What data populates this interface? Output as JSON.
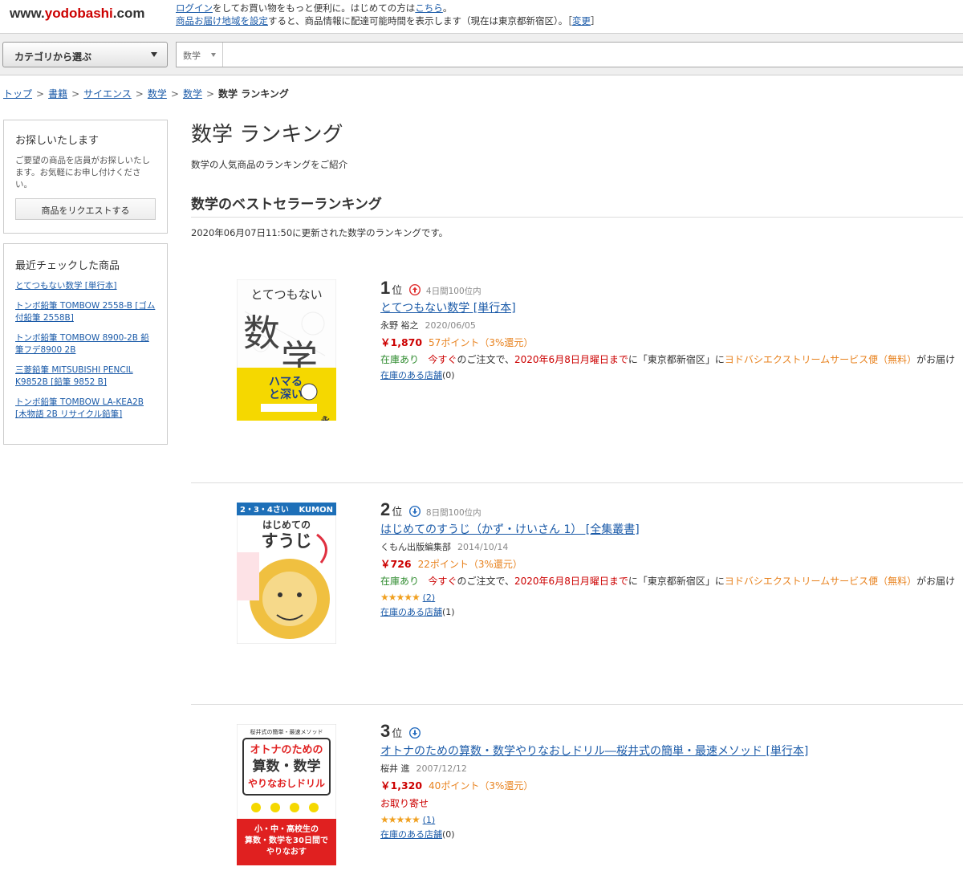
{
  "header": {
    "logo_part1": "www.",
    "logo_part2": "yodobashi",
    "logo_part3": ".com",
    "line1_link1": "ログイン",
    "line1_text1": "をしてお買い物をもっと便利に。はじめての方は",
    "line1_link2": "こちら",
    "line1_text2": "。",
    "line2_link1": "商品お届け地域を設定",
    "line2_text1": "すると、商品情報に配達可能時間を表示します（現在は東京都新宿区）。［",
    "line2_link2": "変更",
    "line2_text2": "］"
  },
  "search": {
    "category_label": "カテゴリから選ぶ",
    "scope_label": "数学",
    "input_value": ""
  },
  "breadcrumb": {
    "items": [
      "トップ",
      "書籍",
      "サイエンス",
      "数学",
      "数学"
    ],
    "separator": ">",
    "current": "数学 ランキング"
  },
  "sidebar": {
    "request": {
      "title": "お探しいたします",
      "text": "ご要望の商品を店員がお探しいたします。お気軽にお申し付けください。",
      "button": "商品をリクエストする"
    },
    "recent": {
      "title": "最近チェックした商品",
      "items": [
        "とてつもない数学 [単行本]",
        "トンボ鉛筆 TOMBOW 2558-B [ゴム付鉛筆 2558B]",
        "トンボ鉛筆 TOMBOW 8900-2B 鉛筆フデ8900 2B",
        "三菱鉛筆 MITSUBISHI PENCIL K9852B [鉛筆 9852 B]",
        "トンボ鉛筆 TOMBOW LA-KEA2B [木物語 2B リサイクル鉛筆]"
      ]
    }
  },
  "main": {
    "title": "数学 ランキング",
    "description": "数学の人気商品のランキングをご紹介",
    "section_title": "数学のベストセラーランキング",
    "updated": "2020年06月07日11:50に更新された数学のランキングです。"
  },
  "ranking": [
    {
      "rank": "1",
      "rank_suffix": "位",
      "trend": "up",
      "trend_icon": "arrow-up-icon",
      "trend_color": "#e03030",
      "note": "4日間100位内",
      "title": "とてつもない数学 [単行本]",
      "author": "永野 裕之",
      "date": "2020/06/05",
      "price": "￥1,870",
      "points": "57ポイント（3%還元）",
      "stock_status": "在庫あり",
      "delivery_a": "今すぐ",
      "delivery_b": "のご注文で、",
      "delivery_c": "2020年6月8日月曜日まで",
      "delivery_d": "に「東京都新宿区」に",
      "delivery_e": "ヨドバシエクストリームサービス便（無料）",
      "delivery_f": "がお届け",
      "store_link": "在庫のある店舗",
      "store_count": "(0)",
      "cover": {
        "bg": "#ffffff",
        "title": "とてつもない",
        "big": "数学",
        "band_color": "#f5d800",
        "author": "永野裕之"
      }
    },
    {
      "rank": "2",
      "rank_suffix": "位",
      "trend": "down",
      "trend_icon": "arrow-down-icon",
      "trend_color": "#2a6fc0",
      "note": "8日間100位内",
      "title": "はじめてのすうじ（かず・けいさん 1） [全集叢書]",
      "author": "くもん出版編集部",
      "date": "2014/10/14",
      "price": "￥726",
      "points": "22ポイント（3%還元）",
      "stock_status": "在庫あり",
      "delivery_a": "今すぐ",
      "delivery_b": "のご注文で、",
      "delivery_c": "2020年6月8日月曜日まで",
      "delivery_d": "に「東京都新宿区」に",
      "delivery_e": "ヨドバシエクストリームサービス便（無料）",
      "delivery_f": "がお届け",
      "review_count": "(2)",
      "rating": 5,
      "store_link": "在庫のある店舗",
      "store_count": "(1)",
      "cover": {
        "bg": "#ffffff",
        "top": "2・3・4さい",
        "brand": "KUMON",
        "title1": "はじめての",
        "title2": "すうじ"
      }
    },
    {
      "rank": "3",
      "rank_suffix": "位",
      "trend": "down",
      "trend_icon": "arrow-down-icon",
      "trend_color": "#2a6fc0",
      "note": "",
      "title": "オトナのための算数・数学やりなおしドリル―桜井式の簡単・最速メソッド [単行本]",
      "author": "桜井 進",
      "date": "2007/12/12",
      "price": "￥1,320",
      "points": "40ポイント（3%還元）",
      "order_status": "お取り寄せ",
      "review_count": "(1)",
      "rating": 5,
      "store_link": "在庫のある店舗",
      "store_count": "(0)",
      "cover": {
        "top": "桜井式の簡単・最速メソッド",
        "t1": "オトナのための",
        "t2": "算数・数学",
        "t3": "やりなおしドリル",
        "band_text1": "小・中・高校生の",
        "band_text2": "算数・数学を30日間で",
        "band_text3": "やりなおす",
        "band_color": "#e02020"
      }
    }
  ]
}
